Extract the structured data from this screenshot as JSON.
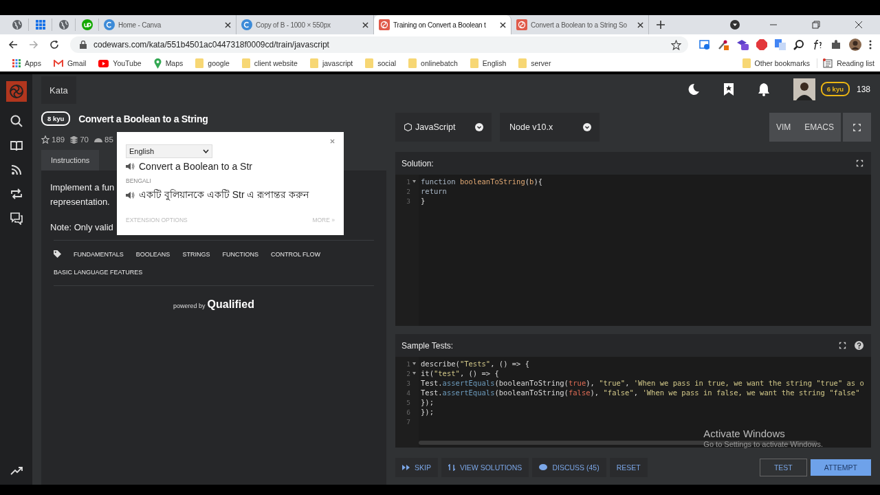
{
  "browser": {
    "pinned_tabs": [
      {
        "kind": "globe"
      },
      {
        "kind": "apps"
      },
      {
        "kind": "globe"
      },
      {
        "kind": "badge"
      }
    ],
    "tabs": [
      {
        "kind": "page",
        "label": "Home - Canva",
        "selected": false
      },
      {
        "kind": "page",
        "label": "Copy of B - 1000 × 550px",
        "selected": false
      },
      {
        "kind": "site",
        "label": "Training on Convert a Boolean t",
        "selected": true
      },
      {
        "kind": "site",
        "label": "Convert a Boolean to a String So",
        "selected": false
      }
    ],
    "address": "codewars.com/kata/551b4501ac0447318f0009cd/train/javascript",
    "bookmarks": [
      {
        "kind": "apps",
        "label": "Apps"
      },
      {
        "kind": "mail",
        "label": "Gmail"
      },
      {
        "kind": "video",
        "label": "YouTube"
      },
      {
        "kind": "pin",
        "label": "Maps"
      },
      {
        "kind": "folder",
        "label": "google"
      },
      {
        "kind": "folder",
        "label": "client website"
      },
      {
        "kind": "folder",
        "label": "javascript"
      },
      {
        "kind": "folder",
        "label": "social"
      },
      {
        "kind": "folder",
        "label": "onlinebatch"
      },
      {
        "kind": "folder",
        "label": "English"
      },
      {
        "kind": "folder",
        "label": "server"
      }
    ],
    "other_bookmarks": "Other bookmarks",
    "reading_list": "Reading list"
  },
  "header": {
    "nav_tab": "Kata",
    "rank": "6 kyu",
    "honor": "138"
  },
  "kata": {
    "rank": "8 kyu",
    "title": "Convert a Boolean to a String",
    "stats": [
      "189",
      "70",
      "85"
    ],
    "tabs": [
      {
        "label": "Instructions",
        "selected": true
      }
    ],
    "description": [
      "Implement a fun",
      "representation."
    ],
    "note": "Note: Only valid",
    "tags": [
      "FUNDAMENTALS",
      "BOOLEANS",
      "STRINGS",
      "FUNCTIONS",
      "CONTROL FLOW",
      "BASIC LANGUAGE FEATURES"
    ],
    "powered_by": "powered by",
    "powered_brand": "Qualified"
  },
  "translate_popup": {
    "language": "English",
    "source": "Convert a Boolean to a Str",
    "target_label": "BENGALI",
    "translation": "একটি বুলিয়ানকে একটি Str এ রূপান্তর করুন",
    "options": "EXTENSION OPTIONS",
    "more": "MORE »"
  },
  "editor": {
    "language": "JavaScript",
    "version": "Node v10.x",
    "modes": [
      "VIM",
      "EMACS"
    ],
    "solution_title": "Solution:",
    "solution": [
      {
        "number": "1",
        "fold": true,
        "tokens": [
          {
            "kind": "kw",
            "text": "function "
          },
          {
            "kind": "fn",
            "text": "booleanToString"
          },
          {
            "kind": "plain",
            "text": "("
          },
          {
            "kind": "fn",
            "text": "b"
          },
          {
            "kind": "plain",
            "text": "){"
          }
        ]
      },
      {
        "number": "2",
        "fold": false,
        "tokens": [
          {
            "kind": "kw",
            "text": "  return"
          }
        ]
      },
      {
        "number": "3",
        "fold": false,
        "tokens": [
          {
            "kind": "plain",
            "text": "}"
          }
        ]
      }
    ],
    "tests_title": "Sample Tests:",
    "tests": [
      {
        "number": "1",
        "fold": true,
        "tokens": [
          {
            "kind": "plain",
            "text": "describe("
          },
          {
            "kind": "str",
            "text": "\"Tests\""
          },
          {
            "kind": "plain",
            "text": ", () => {"
          }
        ]
      },
      {
        "number": "2",
        "fold": true,
        "tokens": [
          {
            "kind": "plain",
            "text": "  it("
          },
          {
            "kind": "str",
            "text": "\"test\""
          },
          {
            "kind": "plain",
            "text": ", () => {"
          }
        ]
      },
      {
        "number": "3",
        "fold": false,
        "tokens": [
          {
            "kind": "plain",
            "text": "Test."
          },
          {
            "kind": "method",
            "text": "assertEquals"
          },
          {
            "kind": "plain",
            "text": "(booleanToString("
          },
          {
            "kind": "bool",
            "text": "true"
          },
          {
            "kind": "plain",
            "text": "), "
          },
          {
            "kind": "str",
            "text": "\"true\""
          },
          {
            "kind": "plain",
            "text": ", "
          },
          {
            "kind": "str",
            "text": "'When we pass in true, we want the string \"true\" as o"
          }
        ]
      },
      {
        "number": "4",
        "fold": false,
        "tokens": [
          {
            "kind": "plain",
            "text": "Test."
          },
          {
            "kind": "method",
            "text": "assertEquals"
          },
          {
            "kind": "plain",
            "text": "(booleanToString("
          },
          {
            "kind": "bool",
            "text": "false"
          },
          {
            "kind": "plain",
            "text": "), "
          },
          {
            "kind": "str",
            "text": "\"false\""
          },
          {
            "kind": "plain",
            "text": ", "
          },
          {
            "kind": "str",
            "text": "'When we pass in false, we want the string \"false\""
          }
        ]
      },
      {
        "number": "5",
        "fold": false,
        "tokens": [
          {
            "kind": "plain",
            "text": "  });"
          }
        ]
      },
      {
        "number": "6",
        "fold": false,
        "tokens": [
          {
            "kind": "plain",
            "text": "});"
          }
        ]
      },
      {
        "number": "7",
        "fold": false
      }
    ],
    "actions": [
      {
        "kind": "skip",
        "label": "SKIP"
      },
      {
        "kind": "solutions",
        "label": "VIEW SOLUTIONS"
      },
      {
        "kind": "discuss",
        "label": "DISCUSS (45)"
      },
      {
        "kind": "plain",
        "label": "RESET"
      }
    ],
    "submit": [
      {
        "kind": "outline",
        "label": "TEST"
      },
      {
        "kind": "primary",
        "label": "ATTEMPT"
      }
    ]
  },
  "os_notice": {
    "title": "Activate Windows",
    "text": "Go to Settings to activate Windows."
  }
}
